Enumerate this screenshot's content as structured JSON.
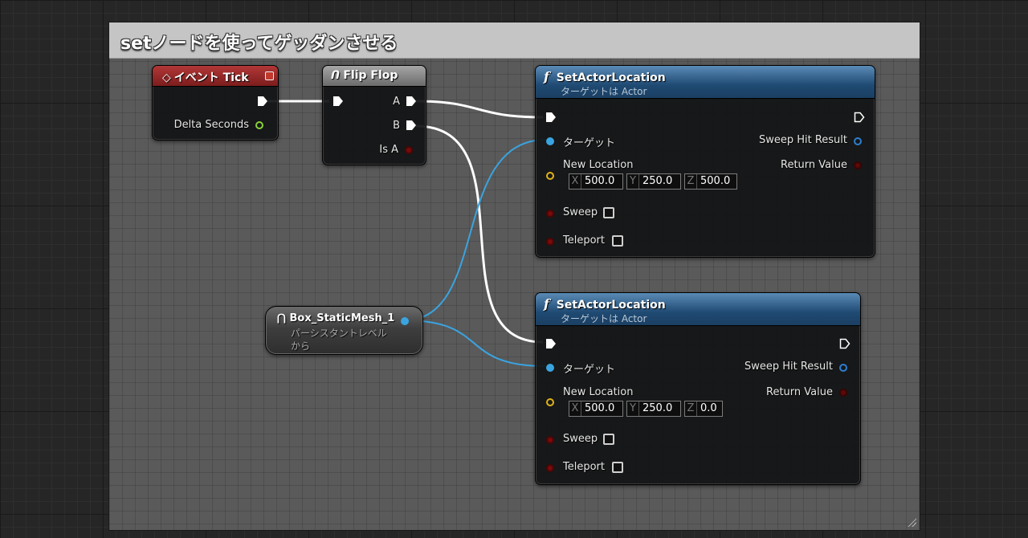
{
  "comment": {
    "title": "setノードを使ってゲッダンさせる"
  },
  "event_tick": {
    "title": "イベント Tick",
    "delta_seconds": "Delta Seconds"
  },
  "flip_flop": {
    "title": "Flip Flop",
    "pin_a": "A",
    "pin_b": "B",
    "is_a": "Is A"
  },
  "box_mesh": {
    "title": "Box_StaticMesh_1",
    "subtitle_line1": "パーシスタントレベル",
    "subtitle_line2": "から"
  },
  "set_actor_1": {
    "title": "SetActorLocation",
    "subtitle": "ターゲットは Actor",
    "target": "ターゲット",
    "new_location": "New Location",
    "x": "500.0",
    "y": "250.0",
    "z": "500.0",
    "sweep": "Sweep",
    "teleport": "Teleport",
    "sweep_hit_result": "Sweep Hit Result",
    "return_value": "Return Value"
  },
  "set_actor_2": {
    "title": "SetActorLocation",
    "subtitle": "ターゲットは Actor",
    "target": "ターゲット",
    "new_location": "New Location",
    "x": "500.0",
    "y": "250.0",
    "z": "0.0",
    "sweep": "Sweep",
    "teleport": "Teleport",
    "sweep_hit_result": "Sweep Hit Result",
    "return_value": "Return Value"
  },
  "axis_labels": {
    "x": "X",
    "y": "Y",
    "z": "Z"
  },
  "colors": {
    "exec_wire": "#ffffff",
    "object_wire": "#3aa4e0",
    "event_header": "#9a2a2a",
    "function_header": "#2a5a85"
  }
}
